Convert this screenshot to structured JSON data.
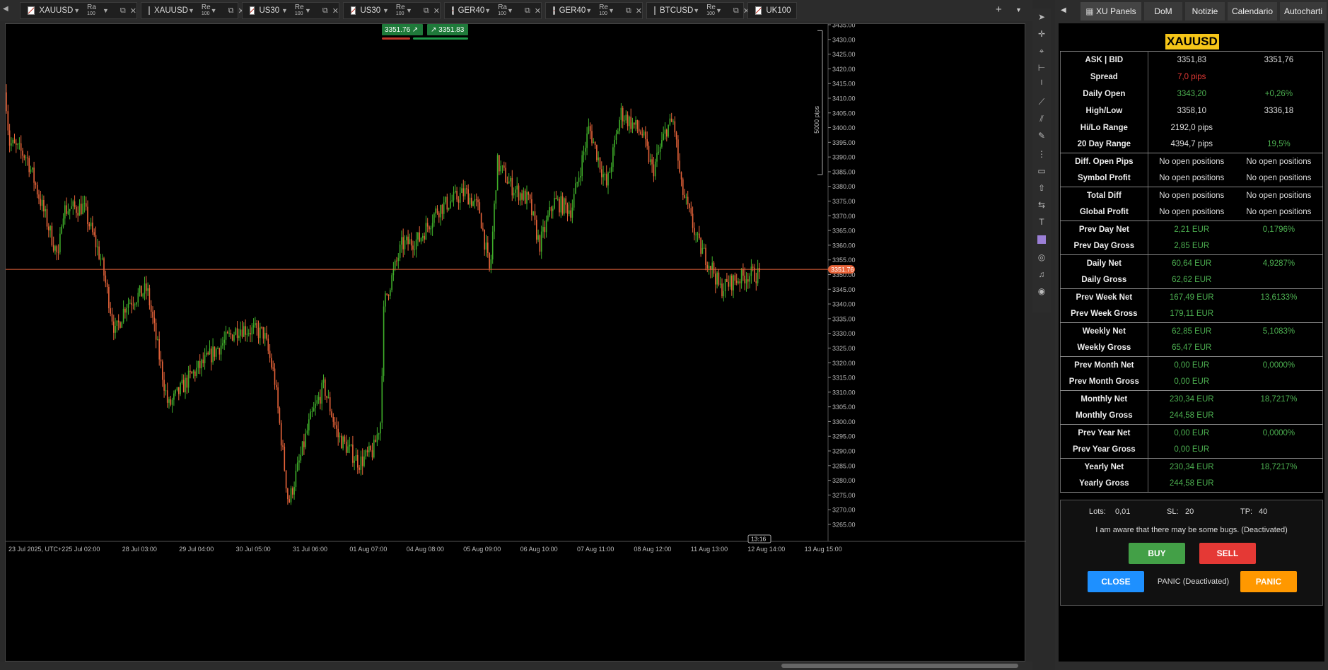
{
  "tabs": [
    {
      "symbol": "XAUUSD",
      "ra": "Ra",
      "ra_n": "100"
    },
    {
      "symbol": "XAUUSD",
      "ra": "Re",
      "ra_n": "100"
    },
    {
      "symbol": "US30",
      "ra": "Re",
      "ra_n": "100"
    },
    {
      "symbol": "US30",
      "ra": "Re",
      "ra_n": "100"
    },
    {
      "symbol": "GER40",
      "ra": "Ra",
      "ra_n": "100"
    },
    {
      "symbol": "GER40",
      "ra": "Re",
      "ra_n": "100"
    },
    {
      "symbol": "BTCUSD",
      "ra": "Re",
      "ra_n": "100"
    },
    {
      "symbol": "UK100"
    }
  ],
  "sidebar_tabs": [
    "XU Panels",
    "DoM",
    "Notizie",
    "Calendario",
    "Autocharti"
  ],
  "chart": {
    "sell_price": "3351.76",
    "buy_price": "3351.83",
    "current_price_label": "3351.76",
    "pips_label": "5000 pips",
    "countdown": "13:16",
    "price_ticks": [
      "3435.00",
      "3430.00",
      "3425.00",
      "3420.00",
      "3415.00",
      "3410.00",
      "3405.00",
      "3400.00",
      "3395.00",
      "3390.00",
      "3385.00",
      "3380.00",
      "3375.00",
      "3370.00",
      "3365.00",
      "3360.00",
      "3355.00",
      "3350.00",
      "3345.00",
      "3340.00",
      "3335.00",
      "3330.00",
      "3325.00",
      "3320.00",
      "3315.00",
      "3310.00",
      "3305.00",
      "3300.00",
      "3295.00",
      "3290.00",
      "3285.00",
      "3280.00",
      "3275.00",
      "3270.00",
      "3265.00"
    ],
    "time_ticks": [
      "23 Jul 2025, UTC+2",
      "25 Jul 02:00",
      "28 Jul 03:00",
      "29 Jul 04:00",
      "30 Jul 05:00",
      "31 Jul 06:00",
      "01 Aug 07:00",
      "04 Aug 08:00",
      "05 Aug 09:00",
      "06 Aug 10:00",
      "07 Aug 11:00",
      "08 Aug 12:00",
      "11 Aug 13:00",
      "12 Aug 14:00",
      "13 Aug 15:00"
    ],
    "colors": {
      "up": "#3fae2a",
      "down": "#e8643a",
      "price_line": "#e8643a"
    }
  },
  "panel": {
    "symbol": "XAUUSD",
    "rows": [
      {
        "label": "ASK | BID",
        "v1": "3351,83",
        "v2": "3351,76",
        "c1": "w",
        "c2": "w",
        "grp": "top"
      },
      {
        "label": "Spread",
        "v1": "7,0 pips",
        "v2": "",
        "c1": "r",
        "c2": "w"
      },
      {
        "label": "Daily Open",
        "v1": "3343,20",
        "v2": "+0,26%",
        "c1": "g",
        "c2": "g"
      },
      {
        "label": "High/Low",
        "v1": "3358,10",
        "v2": "3336,18",
        "c1": "w",
        "c2": "w"
      },
      {
        "label": "Hi/Lo Range",
        "v1": "2192,0 pips",
        "v2": "",
        "c1": "w",
        "c2": "w"
      },
      {
        "label": "20 Day Range",
        "v1": "4394,7 pips",
        "v2": "19,5%",
        "c1": "w",
        "c2": "g",
        "grp": "end"
      },
      {
        "label": "Diff. Open Pips",
        "v1": "No open positions",
        "v2": "No open positions",
        "c1": "w",
        "c2": "w",
        "grp": "top"
      },
      {
        "label": "Symbol Profit",
        "v1": "No open positions",
        "v2": "No open positions",
        "c1": "w",
        "c2": "w",
        "grp": "end"
      },
      {
        "label": "Total Diff",
        "v1": "No open positions",
        "v2": "No open positions",
        "c1": "w",
        "c2": "w",
        "grp": "top"
      },
      {
        "label": "Global Profit",
        "v1": "No open positions",
        "v2": "No open positions",
        "c1": "w",
        "c2": "w",
        "grp": "end"
      },
      {
        "label": "Prev Day Net",
        "v1": "2,21 EUR",
        "v2": "0,1796%",
        "c1": "g",
        "c2": "g",
        "grp": "top"
      },
      {
        "label": "Prev Day Gross",
        "v1": "2,85 EUR",
        "v2": "",
        "c1": "g",
        "c2": "g",
        "grp": "end"
      },
      {
        "label": "Daily Net",
        "v1": "60,64 EUR",
        "v2": "4,9287%",
        "c1": "g",
        "c2": "g",
        "grp": "top"
      },
      {
        "label": "Daily Gross",
        "v1": "62,62 EUR",
        "v2": "",
        "c1": "g",
        "c2": "g",
        "grp": "end"
      },
      {
        "label": "Prev Week Net",
        "v1": "167,49 EUR",
        "v2": "13,6133%",
        "c1": "g",
        "c2": "g",
        "grp": "top"
      },
      {
        "label": "Prev Week Gross",
        "v1": "179,11 EUR",
        "v2": "",
        "c1": "g",
        "c2": "g",
        "grp": "end"
      },
      {
        "label": "Weekly Net",
        "v1": "62,85 EUR",
        "v2": "5,1083%",
        "c1": "g",
        "c2": "g",
        "grp": "top"
      },
      {
        "label": "Weekly Gross",
        "v1": "65,47 EUR",
        "v2": "",
        "c1": "g",
        "c2": "g",
        "grp": "end"
      },
      {
        "label": "Prev Month Net",
        "v1": "0,00 EUR",
        "v2": "0,0000%",
        "c1": "g",
        "c2": "g",
        "grp": "top"
      },
      {
        "label": "Prev Month Gross",
        "v1": "0,00 EUR",
        "v2": "",
        "c1": "g",
        "c2": "g",
        "grp": "end"
      },
      {
        "label": "Monthly Net",
        "v1": "230,34 EUR",
        "v2": "18,7217%",
        "c1": "g",
        "c2": "g",
        "grp": "top"
      },
      {
        "label": "Monthly Gross",
        "v1": "244,58 EUR",
        "v2": "",
        "c1": "g",
        "c2": "g",
        "grp": "end"
      },
      {
        "label": "Prev Year Net",
        "v1": "0,00 EUR",
        "v2": "0,0000%",
        "c1": "g",
        "c2": "g",
        "grp": "top"
      },
      {
        "label": "Prev Year Gross",
        "v1": "0,00 EUR",
        "v2": "",
        "c1": "g",
        "c2": "g",
        "grp": "end"
      },
      {
        "label": "Yearly Net",
        "v1": "230,34 EUR",
        "v2": "18,7217%",
        "c1": "g",
        "c2": "g",
        "grp": "top"
      },
      {
        "label": "Yearly Gross",
        "v1": "244,58 EUR",
        "v2": "",
        "c1": "g",
        "c2": "g",
        "grp": "end"
      }
    ]
  },
  "trade": {
    "lots_label": "Lots:",
    "lots_value": "0,01",
    "sl_label": "SL:",
    "sl_value": "20",
    "tp_label": "TP:",
    "tp_value": "40",
    "warning": "I am aware that there may be some bugs. (Deactivated)",
    "buy": "BUY",
    "sell": "SELL",
    "close": "CLOSE",
    "panic_status": "PANIC (Deactivated)",
    "panic": "PANIC",
    "colors": {
      "buy": "#43a047",
      "sell": "#e53935",
      "close": "#1e90ff",
      "panic": "#ff9800"
    }
  }
}
